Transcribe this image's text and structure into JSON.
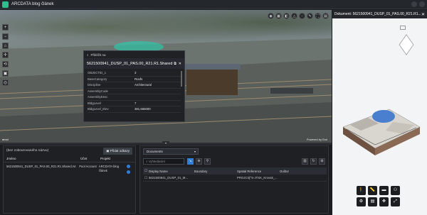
{
  "app": {
    "title": "ARCDATA blog článek"
  },
  "viewer": {
    "powered_by": "Powered by Esri",
    "left_tools": [
      "+",
      "−",
      "⌂",
      "✛",
      "⟲",
      "▣",
      "◎"
    ],
    "top_tools": [
      "◉",
      "▦",
      "◧",
      "△",
      "◌",
      "✎",
      "⛶",
      "▤"
    ]
  },
  "popup": {
    "header": "Přiblížit na",
    "title": "5621500941_DUSP_01_PAS.00_R21.R1.Shared",
    "attributes": [
      {
        "key": "OBJECTID_1",
        "value": "3"
      },
      {
        "key": "BaseCategory",
        "value": "Roofs"
      },
      {
        "key": "Discipline",
        "value": "Architectural"
      },
      {
        "key": "AssemblyCode",
        "value": ""
      },
      {
        "key": "AssemblyDesc",
        "value": ""
      },
      {
        "key": "BldgLevel",
        "value": "7"
      },
      {
        "key": "BldgLevel_Elev",
        "value": "381,665000"
      }
    ]
  },
  "right_panel": {
    "title": "Dokument: 5621500941_DUSP_01_PAS.00_R21.R1...",
    "tools": [
      "🚶",
      "📏",
      "▬",
      "⚇",
      "⚙",
      "▤",
      "✥",
      "⤢"
    ]
  },
  "attachments": {
    "header": "(bez zobrazovaného názvu)",
    "add_button": "Přidat odkazy",
    "columns": [
      "Jméno",
      "Účet",
      "Projekt"
    ],
    "row": {
      "name": "5621500941_DUSP_01_PAS.00_R21.R1.Shared.rvt",
      "account": "Pool Account",
      "project": "ARCDATA blog článek"
    }
  },
  "documents": {
    "select_label": "Documents",
    "search_placeholder": "Vyhledávání",
    "columns": [
      "Display Name",
      "Boundary",
      "Spatial Reference",
      "Ouštor"
    ],
    "rows": [
      [
        "5621500941_DUSP_01_M...",
        "",
        "PROJCS[\"S-JTSK_Krovak_...",
        ""
      ]
    ]
  }
}
